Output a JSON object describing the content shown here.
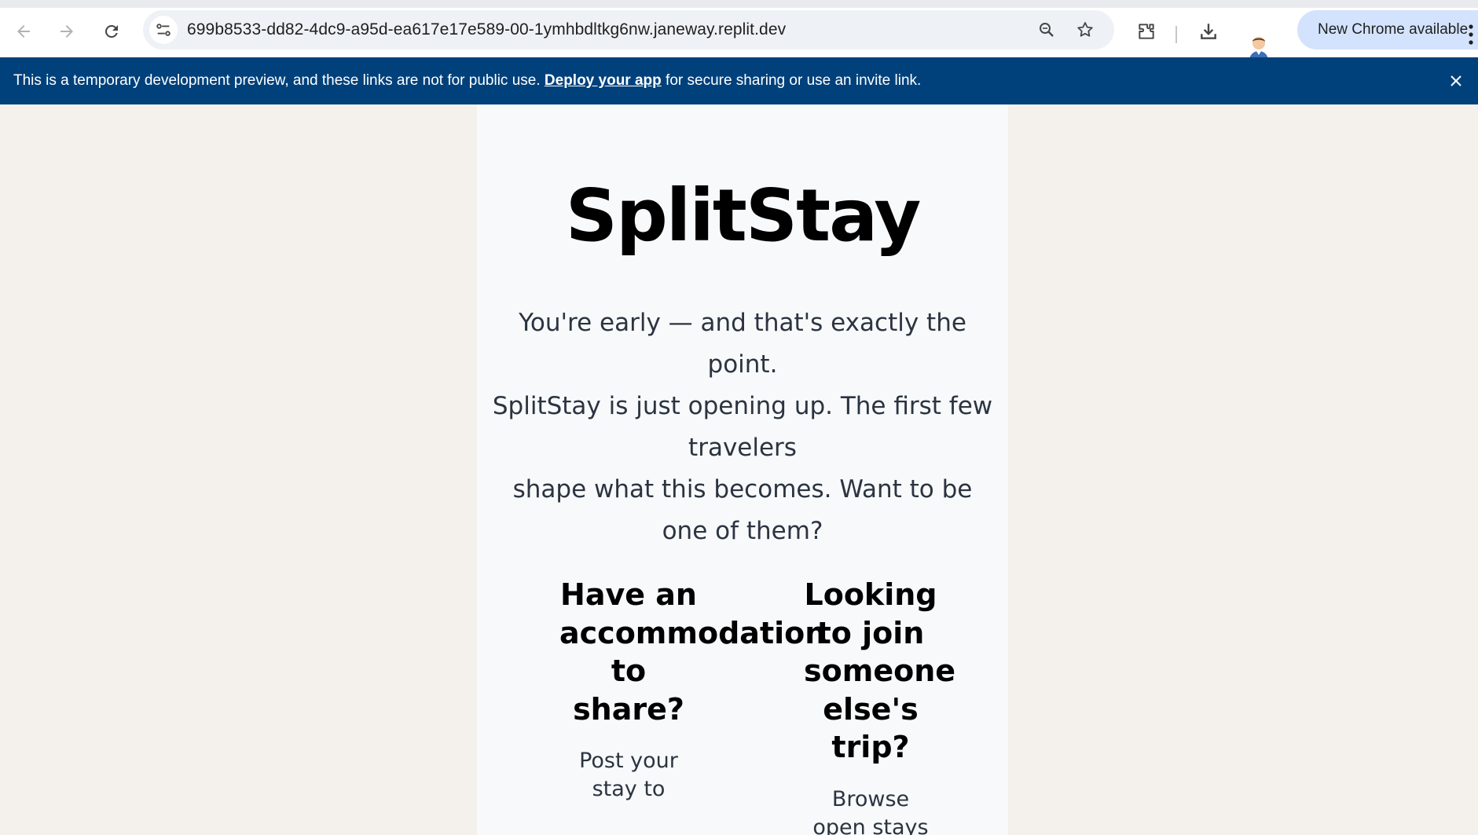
{
  "browser": {
    "url": "699b8533-dd82-4dc9-a95d-ea617e17e589-00-1ymhbdltkg6nw.janeway.replit.dev",
    "update_label": "New Chrome available",
    "icons": [
      "back-icon",
      "forward-icon",
      "reload-icon",
      "site-info-icon",
      "zoom-icon",
      "bookmark-star-icon",
      "extensions-icon",
      "download-icon",
      "profile-avatar",
      "more-menu-icon"
    ]
  },
  "banner": {
    "text_before": "This is a temporary development preview, and these links are not for public use.",
    "link_label": "Deploy your app",
    "text_after": "for secure sharing or use an invite link."
  },
  "page": {
    "title": "SplitStay",
    "intro_line1": "You're early — and that's exactly the point.",
    "intro_line2": "SplitStay is just opening up. The first few travelers",
    "intro_line3": "shape what this becomes. Want to be one of them?",
    "host_card": {
      "title": "Have an accommodation to share?",
      "desc": "Post your stay to"
    },
    "guest_card": {
      "title": "Looking to join someone else's trip?",
      "desc": "Browse open stays"
    }
  },
  "colors": {
    "banner_bg": "#00417b",
    "page_bg": "#f4f1ec",
    "card_bg": "#f8f9fb",
    "update_pill_bg": "#d3e3fd"
  }
}
